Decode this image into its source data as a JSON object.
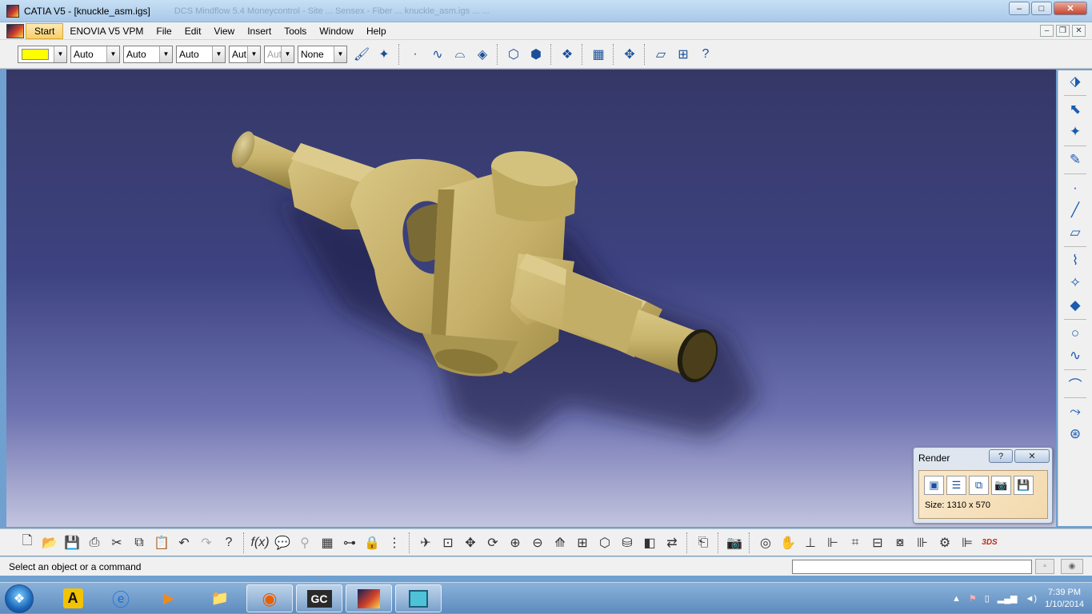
{
  "window": {
    "title": "CATIA V5 - [knuckle_asm.igs]",
    "ghost_tabs": "DCS Mindflow 5.4                     Moneycontrol - Site ... Sensex - Fiber ...           knuckle_asm.igs ...                                        ..."
  },
  "window_buttons": {
    "minimize": "–",
    "maximize": "□",
    "close": "✕"
  },
  "menu": {
    "items": [
      "Start",
      "ENOVIA V5 VPM",
      "File",
      "Edit",
      "View",
      "Insert",
      "Tools",
      "Window",
      "Help"
    ]
  },
  "mdi_buttons": {
    "minimize": "–",
    "restore": "❐",
    "close": "✕"
  },
  "graphic_properties": {
    "color_swatch": "#ffff00",
    "transparency": "Auto",
    "line_thickness": "Auto",
    "line_type": "Auto",
    "point_type": "Aut",
    "render_style": "Aut",
    "layer": "None"
  },
  "render_panel": {
    "title": "Render",
    "help_label": "?",
    "close_label": "✕",
    "size_label": "Size: 1310 x 570"
  },
  "status": {
    "prompt": "Select an object or a command"
  },
  "taskbar": {
    "apps": [
      "Nortonland",
      "Internet Explorer",
      "Media Player",
      "Windows Explorer",
      "Firefox",
      "GC",
      "CATIA V5",
      "Solid Edge"
    ],
    "gc_label": "GC",
    "time": "7:39 PM",
    "date": "1/10/2014"
  },
  "colors": {
    "viewport_top": "#353866",
    "viewport_bottom": "#c3c4df",
    "part_color": "#c9b56e",
    "title_bar": "#b7d3ef"
  }
}
